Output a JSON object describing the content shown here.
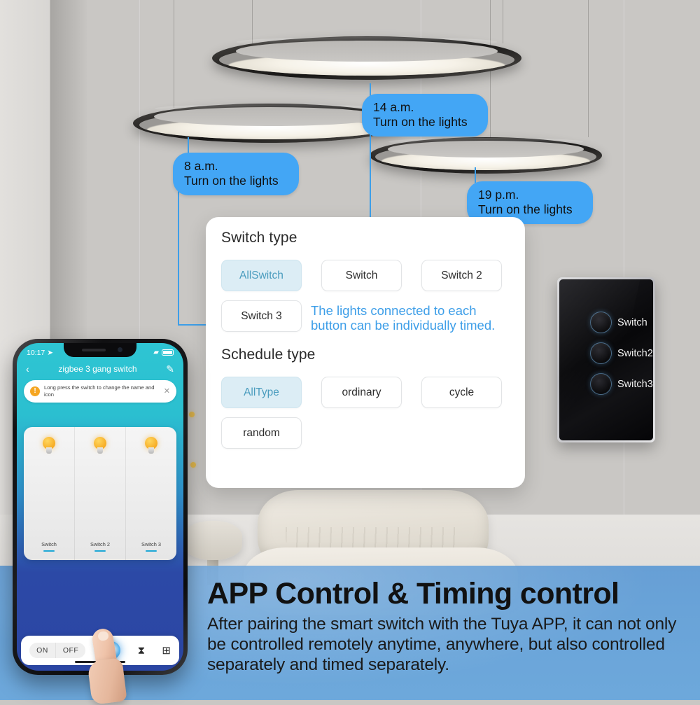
{
  "scene": {
    "callouts": [
      {
        "time": "8 a.m.",
        "action": "Turn on the lights"
      },
      {
        "time": "14 a.m.",
        "action": "Turn on the lights"
      },
      {
        "time": "19 p.m.",
        "action": "Turn on the lights"
      }
    ]
  },
  "card": {
    "switch_type": {
      "title": "Switch type",
      "options": [
        {
          "label": "AllSwitch",
          "selected": true
        },
        {
          "label": "Switch",
          "selected": false
        },
        {
          "label": "Switch 2",
          "selected": false
        },
        {
          "label": "Switch 3",
          "selected": false
        }
      ],
      "note": "The lights connected to each button can be individually timed."
    },
    "schedule_type": {
      "title": "Schedule type",
      "options": [
        {
          "label": "AllType",
          "selected": true
        },
        {
          "label": "ordinary",
          "selected": false
        },
        {
          "label": "cycle",
          "selected": false
        },
        {
          "label": "random",
          "selected": false
        }
      ]
    }
  },
  "wall_switch": {
    "buttons": [
      {
        "label": "Switch"
      },
      {
        "label": "Switch2"
      },
      {
        "label": "Switch3"
      }
    ]
  },
  "phone": {
    "status": {
      "time": "10:17",
      "location_icon": "location-arrow-icon",
      "carrier": "",
      "wifi_icon": "wifi-icon",
      "battery_icon": "battery-icon"
    },
    "nav": {
      "back_icon": "chevron-left-icon",
      "title": "zigbee 3 gang switch",
      "edit_icon": "pencil-icon"
    },
    "banner": {
      "icon": "warning-icon",
      "text": "Long press the switch to change the name and icon",
      "close_icon": "close-icon"
    },
    "switches": [
      {
        "label": "Switch",
        "icon": "bulb-icon"
      },
      {
        "label": "Switch 2",
        "icon": "bulb-icon"
      },
      {
        "label": "Switch 3",
        "icon": "bulb-icon"
      }
    ],
    "toolbar": {
      "on_label": "ON",
      "off_label": "OFF",
      "power_icon": "power-icon",
      "timer_icon": "hourglass-icon",
      "grid_icon": "grid-icon"
    }
  },
  "banner_band": {
    "headline": "APP Control & Timing control",
    "body": "After pairing the smart switch with the Tuya APP,  it can not only be controlled remotely anytime, anywhere, but also controlled separately and timed separately."
  },
  "colors": {
    "callout_blue": "#43a6f5",
    "accent_blue": "#3d9ee8",
    "chip_selected_bg": "#dcedf5",
    "chip_selected_text": "#4a9cbe",
    "band_blue": "#5f9ed8",
    "phone_teal": "#2ec5d3",
    "bulb_yellow": "#f6a920"
  }
}
